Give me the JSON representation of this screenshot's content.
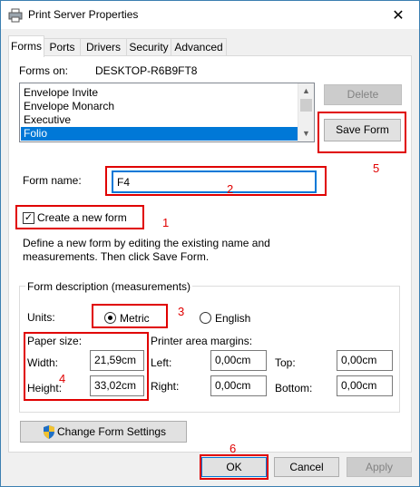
{
  "window": {
    "title": "Print Server Properties",
    "close_glyph": "✕"
  },
  "tabs": [
    {
      "label": "Forms",
      "active": true
    },
    {
      "label": "Ports"
    },
    {
      "label": "Drivers"
    },
    {
      "label": "Security"
    },
    {
      "label": "Advanced"
    }
  ],
  "forms_on": {
    "label": "Forms on:",
    "server": "DESKTOP-R6B9FT8"
  },
  "forms_list": {
    "items": [
      "Envelope Invite",
      "Envelope Monarch",
      "Executive",
      "Folio"
    ],
    "selected": "Folio"
  },
  "buttons": {
    "delete": "Delete",
    "save_form": "Save Form",
    "change_form_settings": "Change Form Settings",
    "ok": "OK",
    "cancel": "Cancel",
    "apply": "Apply"
  },
  "form_name": {
    "label": "Form name:",
    "value": "F4"
  },
  "create_new": {
    "label": "Create a new form",
    "checked": true
  },
  "description": "Define a new form by editing the existing name and measurements. Then click Save Form.",
  "form_description": {
    "title": "Form description (measurements)",
    "units_label": "Units:",
    "metric_label": "Metric",
    "english_label": "English",
    "selected_unit": "Metric",
    "paper_size_label": "Paper size:",
    "width_label": "Width:",
    "width_value": "21,59cm",
    "height_label": "Height:",
    "height_value": "33,02cm",
    "margins_label": "Printer area margins:",
    "left_label": "Left:",
    "left_value": "0,00cm",
    "right_label": "Right:",
    "right_value": "0,00cm",
    "top_label": "Top:",
    "top_value": "0,00cm",
    "bottom_label": "Bottom:",
    "bottom_value": "0,00cm"
  },
  "annotations": [
    "1",
    "2",
    "3",
    "4",
    "5",
    "6"
  ],
  "colors": {
    "annotation": "#e00000",
    "selection": "#0078d7"
  }
}
